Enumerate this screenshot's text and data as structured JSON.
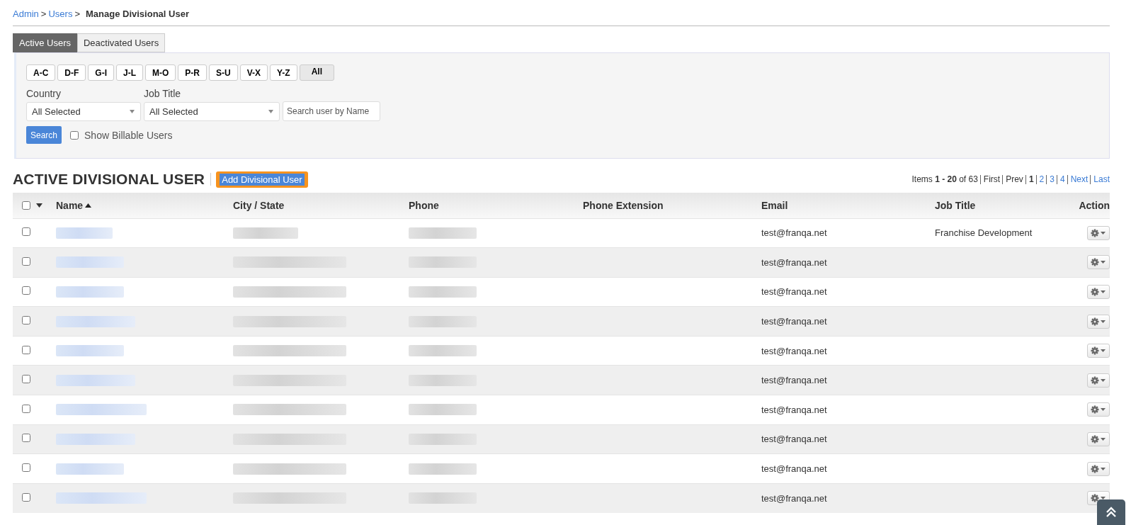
{
  "breadcrumb": [
    {
      "label": "Admin",
      "kind": "link",
      "separator": ">"
    },
    {
      "label": "Users",
      "kind": "link",
      "separator": ">"
    },
    {
      "label": "Manage Divisional User",
      "kind": "current"
    }
  ],
  "tabs": [
    {
      "label": "Active Users",
      "selected": true
    },
    {
      "label": "Deactivated Users",
      "selected": false
    }
  ],
  "letter_filters": [
    {
      "label": "A-C",
      "selected": false
    },
    {
      "label": "D-F",
      "selected": false
    },
    {
      "label": "G-I",
      "selected": false
    },
    {
      "label": "J-L",
      "selected": false
    },
    {
      "label": "M-O",
      "selected": false
    },
    {
      "label": "P-R",
      "selected": false
    },
    {
      "label": "S-U",
      "selected": false
    },
    {
      "label": "V-X",
      "selected": false
    },
    {
      "label": "Y-Z",
      "selected": false
    },
    {
      "label": "All",
      "selected": true
    }
  ],
  "filters": {
    "country": {
      "label": "Country",
      "value": "All Selected"
    },
    "job_title": {
      "label": "Job Title",
      "value": "All Selected"
    },
    "search": {
      "placeholder": "Search user by Name"
    },
    "search_button": "Search",
    "billable": {
      "label": "Show Billable Users",
      "checked": false
    }
  },
  "section": {
    "title": "ACTIVE DIVISIONAL USER",
    "add_button": "Add Divisional User"
  },
  "pagination": {
    "items_prefix": "Items",
    "range": "1 - 20",
    "of_text": "of 63",
    "links": [
      {
        "label": "First",
        "kind": "plain"
      },
      {
        "label": "Prev",
        "kind": "plain"
      },
      {
        "label": "1",
        "kind": "current"
      },
      {
        "label": "2",
        "kind": "link"
      },
      {
        "label": "3",
        "kind": "link"
      },
      {
        "label": "4",
        "kind": "link"
      },
      {
        "label": "Next",
        "kind": "link"
      },
      {
        "label": "Last",
        "kind": "link"
      }
    ]
  },
  "table": {
    "select_all_checked": false,
    "columns": [
      "Name",
      "City / State",
      "Phone",
      "Phone Extension",
      "Email",
      "Job Title",
      "Action"
    ],
    "rows": [
      {
        "checked": false,
        "email": "test@franqa.net",
        "job_title": "Franchise Development"
      },
      {
        "checked": false,
        "email": "test@franqa.net"
      },
      {
        "checked": false,
        "email": "test@franqa.net"
      },
      {
        "checked": false,
        "email": "test@franqa.net"
      },
      {
        "checked": false,
        "email": "test@franqa.net"
      },
      {
        "checked": false,
        "email": "test@franqa.net"
      },
      {
        "checked": false,
        "email": "test@franqa.net"
      },
      {
        "checked": false,
        "email": "test@franqa.net"
      },
      {
        "checked": false,
        "email": "test@franqa.net"
      },
      {
        "checked": false,
        "email": "test@franqa.net"
      }
    ]
  }
}
